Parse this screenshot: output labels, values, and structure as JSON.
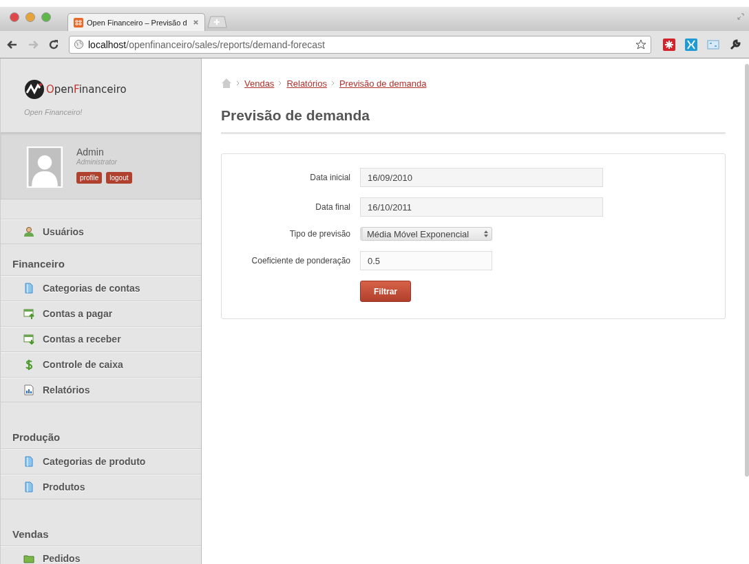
{
  "browser": {
    "tab_title": "Open Financeiro – Previsão d",
    "url": "**localhost**/openfinanceiro/sales/reports/demand-forecast"
  },
  "sidebar": {
    "logo": [
      {
        "text": "O",
        "accent": true
      },
      {
        "text": "pen",
        "accent": false
      },
      {
        "text": "F",
        "accent": true
      },
      {
        "text": "inanceiro",
        "accent": false
      }
    ],
    "tagline": "Open Financeiro!",
    "user": {
      "name": "Admin",
      "role": "Administrator",
      "buttons": [
        "profile",
        "logout"
      ]
    },
    "sections": [
      {
        "items": [
          "Usuários"
        ]
      },
      {
        "title": "Financeiro",
        "items": [
          "Categorias de contas",
          "Contas a pagar",
          "Contas a receber",
          "Controle de caixa",
          "Relatórios"
        ]
      },
      {
        "title": "Produção",
        "items": [
          "Categorias de produto",
          "Produtos"
        ]
      },
      {
        "title": "Vendas",
        "items": [
          "Pedidos"
        ]
      }
    ]
  },
  "breadcrumb": [
    "Vendas",
    "Relatórios",
    "Previsão de demanda"
  ],
  "page_title": "Previsão de demanda",
  "form": {
    "fields": [
      {
        "kind": "text",
        "label": "Data inicial",
        "value": "16/09/2010"
      },
      {
        "kind": "text",
        "label": "Data final",
        "value": "16/10/2011"
      },
      {
        "kind": "select",
        "label": "Tipo de previsão",
        "value": "Média Móvel Exponencial"
      },
      {
        "kind": "short",
        "label": "Coeficiente de ponderação",
        "value": "0.5"
      }
    ],
    "submit": "Filtrar"
  }
}
